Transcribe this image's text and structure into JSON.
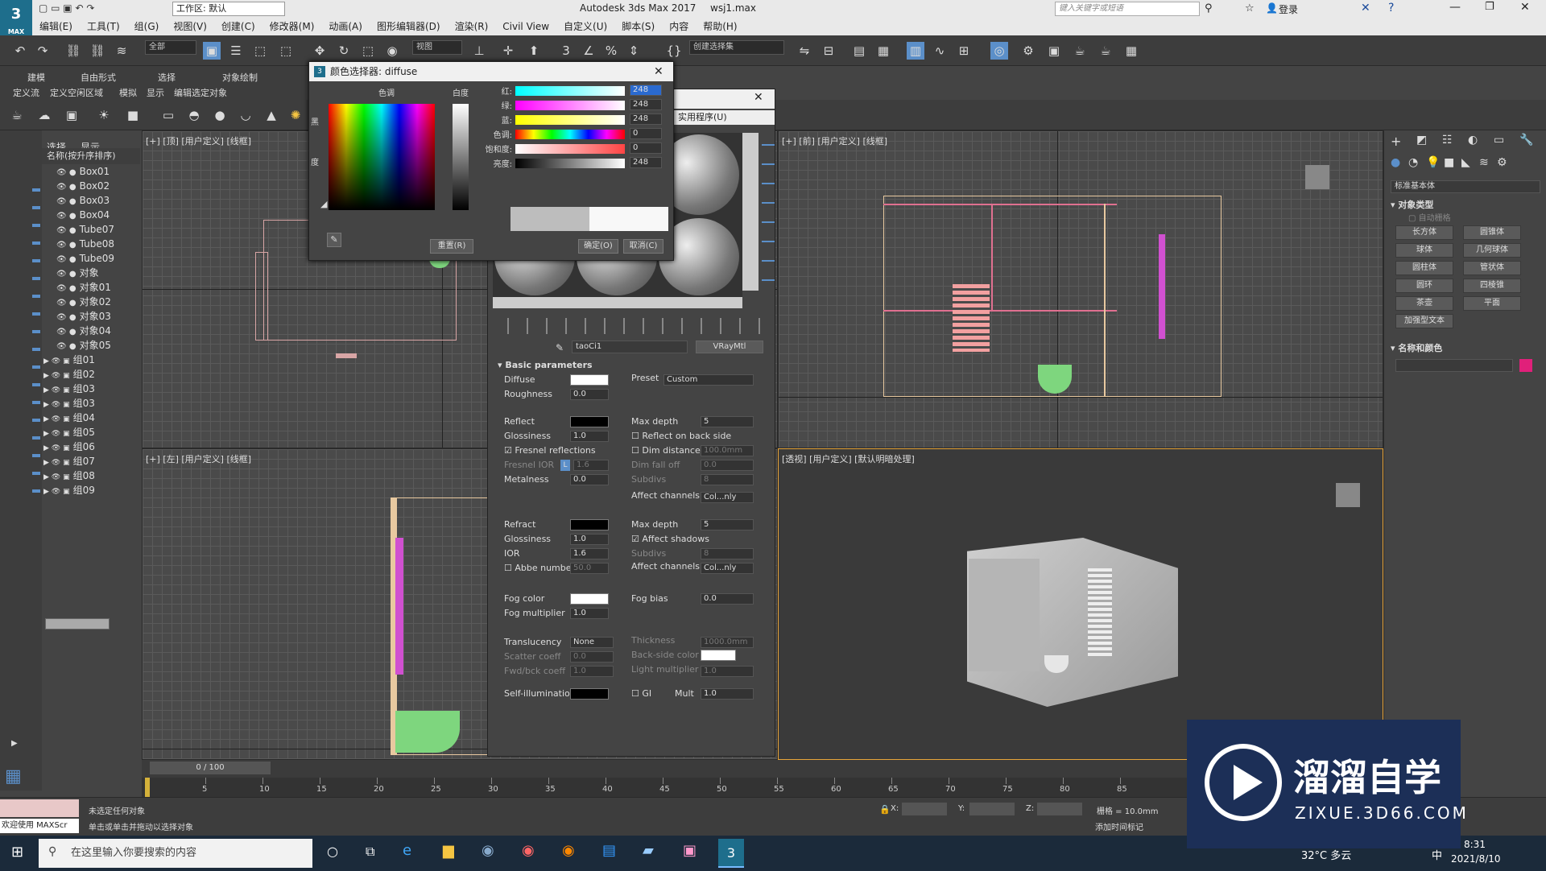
{
  "app": {
    "title": "Autodesk 3ds Max 2017",
    "file": "wsj1.max",
    "workspace": "工作区: 默认",
    "search_placeholder": "键入关键字或短语",
    "login": "登录"
  },
  "menu": [
    "编辑(E)",
    "工具(T)",
    "组(G)",
    "视图(V)",
    "创建(C)",
    "修改器(M)",
    "动画(A)",
    "图形编辑器(D)",
    "渲染(R)",
    "Civil View",
    "自定义(U)",
    "脚本(S)",
    "内容",
    "帮助(H)"
  ],
  "toolbar": {
    "filter": "全部",
    "view": "视图",
    "selection_set": "创建选择集"
  },
  "ribbon": {
    "tabs": [
      "建模",
      "自由形式",
      "选择",
      "对象绘制"
    ],
    "sub": [
      "定义流",
      "定义空闲区域",
      "模拟",
      "显示",
      "编辑选定对象"
    ]
  },
  "explorer": {
    "tabs": [
      "选择",
      "显示"
    ],
    "header": "名称(按升序排序)",
    "items": [
      "Box01",
      "Box02",
      "Box03",
      "Box04",
      "Tube07",
      "Tube08",
      "Tube09",
      "对象",
      "对象01",
      "对象02",
      "对象03",
      "对象04",
      "对象05"
    ],
    "groups": [
      "组01",
      "组02",
      "组03",
      "组03",
      "组04",
      "组05",
      "组06",
      "组07",
      "组08",
      "组09"
    ]
  },
  "viewports": {
    "top": "[+] [顶] [用户定义] [线框]",
    "front": "[+] [前] [用户定义] [线框]",
    "left": "[+] [左] [用户定义] [线框]",
    "persp": "[透视] [用户定义] [默认明暗处理]"
  },
  "color_picker": {
    "title": "颜色选择器: diffuse",
    "hue_label": "色调",
    "white_label": "白度",
    "black_label": "黑",
    "degree_label": "度",
    "rows": [
      {
        "label": "红:",
        "value": "248"
      },
      {
        "label": "绿:",
        "value": "248"
      },
      {
        "label": "蓝:",
        "value": "248"
      },
      {
        "label": "色调:",
        "value": "0"
      },
      {
        "label": "饱和度:",
        "value": "0"
      },
      {
        "label": "亮度:",
        "value": "248"
      }
    ],
    "reset": "重置(R)",
    "ok": "确定(O)",
    "cancel": "取消(C)",
    "colors": {
      "selected": "#f8f8f8",
      "previous": "#bdbdbd"
    }
  },
  "material": {
    "behind_title": "实用程序(U)",
    "name": "taoCi1",
    "type": "VRayMtl",
    "section": "Basic parameters",
    "diffuse": "Diffuse",
    "preset_label": "Preset",
    "preset": "Custom",
    "roughness": "Roughness",
    "roughness_val": "0.0",
    "reflect": "Reflect",
    "max_depth": "Max depth",
    "max_depth_val": "5",
    "glossiness": "Glossiness",
    "gloss_val": "1.0",
    "reflect_back": "Reflect on back side",
    "fresnel": "Fresnel reflections",
    "dim_distance": "Dim distance",
    "dim_distance_val": "100.0mm",
    "fresnel_ior": "Fresnel IOR",
    "fresnel_ior_lock": "L",
    "fresnel_ior_val": "1.6",
    "dim_falloff": "Dim fall off",
    "dim_falloff_val": "0.0",
    "metalness": "Metalness",
    "metalness_val": "0.0",
    "subdivs": "Subdivs",
    "subdivs_val": "8",
    "affect_channels": "Affect channels",
    "affect_channels_val": "Col...nly",
    "refract": "Refract",
    "refract_depth": "5",
    "refract_gloss": "1.0",
    "affect_shadows": "Affect shadows",
    "ior": "IOR",
    "ior_val": "1.6",
    "refract_subdivs": "8",
    "abbe": "Abbe number",
    "abbe_val": "50.0",
    "refract_channels": "Col...nly",
    "fog_color": "Fog color",
    "fog_bias": "Fog bias",
    "fog_bias_val": "0.0",
    "fog_mult": "Fog multiplier",
    "fog_mult_val": "1.0",
    "translucency": "Translucency",
    "translucency_val": "None",
    "thickness": "Thickness",
    "thickness_val": "1000.0mm",
    "scatter": "Scatter coeff",
    "scatter_val": "0.0",
    "backside": "Back-side color",
    "fwd": "Fwd/bck coeff",
    "fwd_val": "1.0",
    "light_mult": "Light multiplier",
    "light_mult_val": "1.0",
    "self_illum": "Self-illumination",
    "gi": "GI",
    "mult": "Mult",
    "mult_val": "1.0"
  },
  "right_panel": {
    "dropdown": "标准基本体",
    "section1": "对象类型",
    "autogrid": "自动栅格",
    "buttons": [
      "长方体",
      "圆锥体",
      "球体",
      "几何球体",
      "圆柱体",
      "管状体",
      "圆环",
      "四棱锥",
      "茶壶",
      "平面",
      "加强型文本"
    ],
    "section2": "名称和颜色",
    "color": "#e0207a"
  },
  "timeline": {
    "frame": "0 / 100",
    "ticks": [
      "0",
      "5",
      "10",
      "15",
      "20",
      "25",
      "30",
      "35",
      "40",
      "45",
      "50",
      "55",
      "60",
      "65",
      "70",
      "75",
      "80",
      "85"
    ]
  },
  "status": {
    "welcome": "欢迎使用 MAXScr",
    "line1": "未选定任何对象",
    "line2": "单击或单击并拖动以选择对象",
    "x": "X:",
    "y": "Y:",
    "z": "Z:",
    "grid": "栅格 = 10.0mm",
    "addtime": "添加时间标记"
  },
  "taskbar": {
    "search": "在这里输入你要搜索的内容",
    "temp": "32°C 多云",
    "ime": "中",
    "time": "8:31",
    "date": "2021/8/10"
  },
  "watermark": {
    "name": "溜溜自学",
    "url": "ZIXUE.3D66.COM"
  }
}
